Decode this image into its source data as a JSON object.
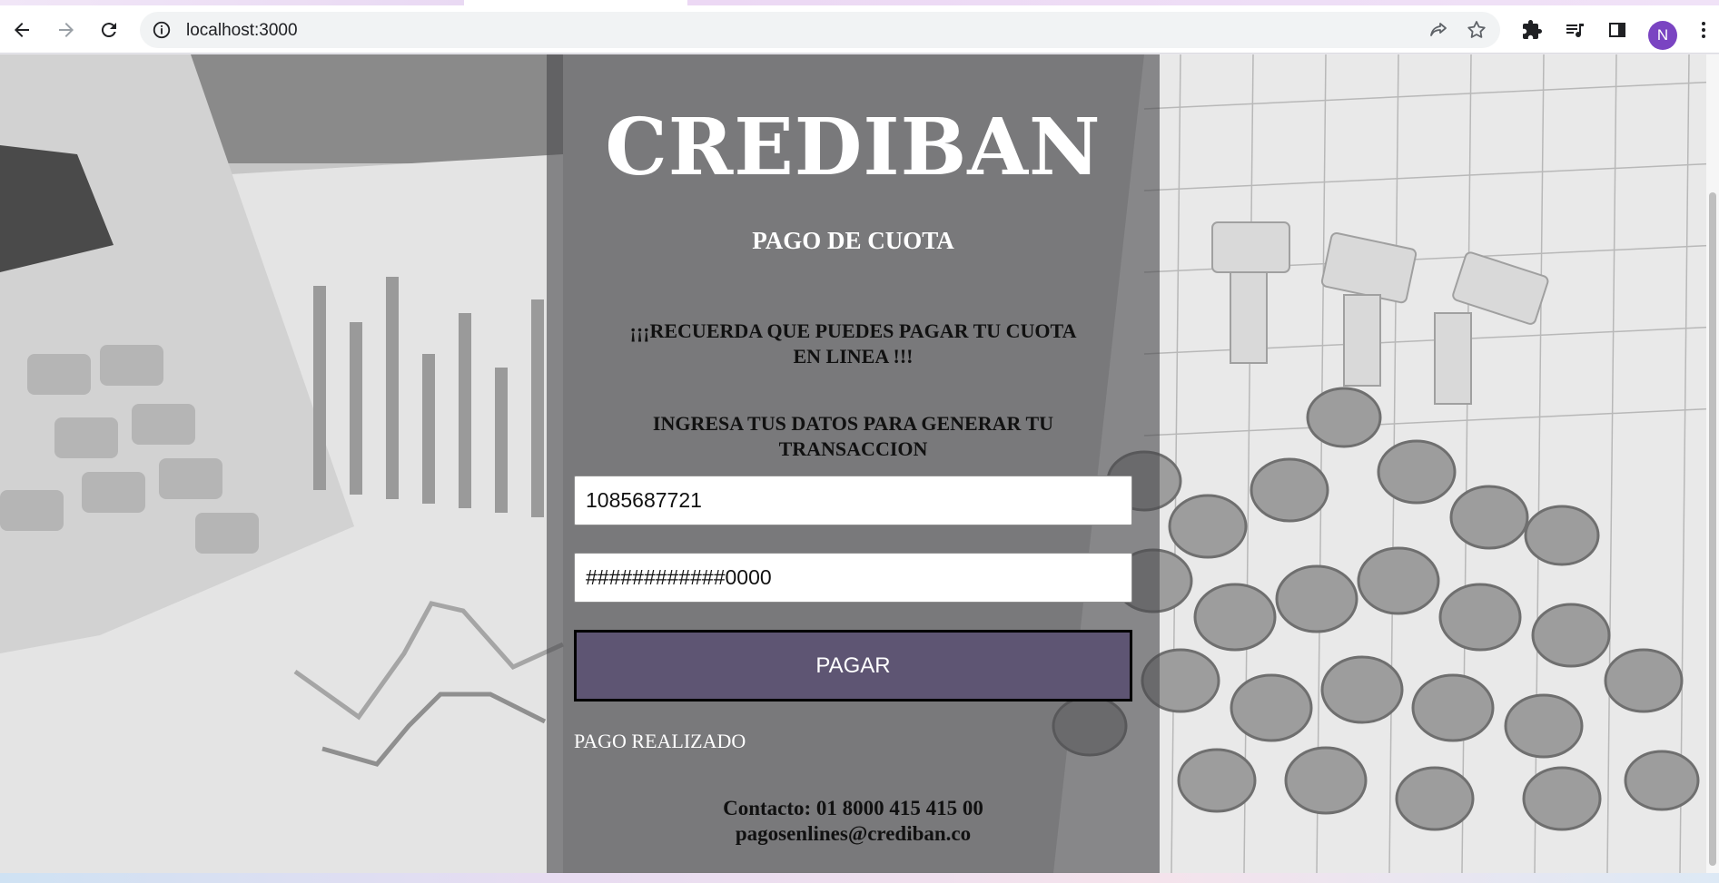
{
  "browser": {
    "url": "localhost:3000",
    "profile_initial": "N",
    "icons": [
      "back-arrow-icon",
      "forward-arrow-icon",
      "reload-icon",
      "site-info-icon",
      "share-icon",
      "bookmark-star-icon",
      "extensions-puzzle-icon",
      "media-queue-icon",
      "side-panel-icon",
      "menu-dots-icon"
    ]
  },
  "page": {
    "brand": "CREDIBAN",
    "subtitle": "PAGO DE CUOTA",
    "notice": "¡¡¡RECUERDA QUE PUEDES PAGAR TU CUOTA EN LINEA !!!",
    "instructions": "INGRESA TUS DATOS PARA GENERAR TU TRANSACCION",
    "document_field": {
      "value": "1085687721"
    },
    "card_field": {
      "value": "############0000"
    },
    "pay_button": "PAGAR",
    "status": "PAGO REALIZADO",
    "contact_phone": "Contacto: 01 8000 415 415 00",
    "contact_email": "pagosenlines@crediban.co"
  },
  "colors": {
    "card_overlay": "#4b4b4e",
    "button": "#5e5573",
    "avatar": "#7a44c2"
  }
}
